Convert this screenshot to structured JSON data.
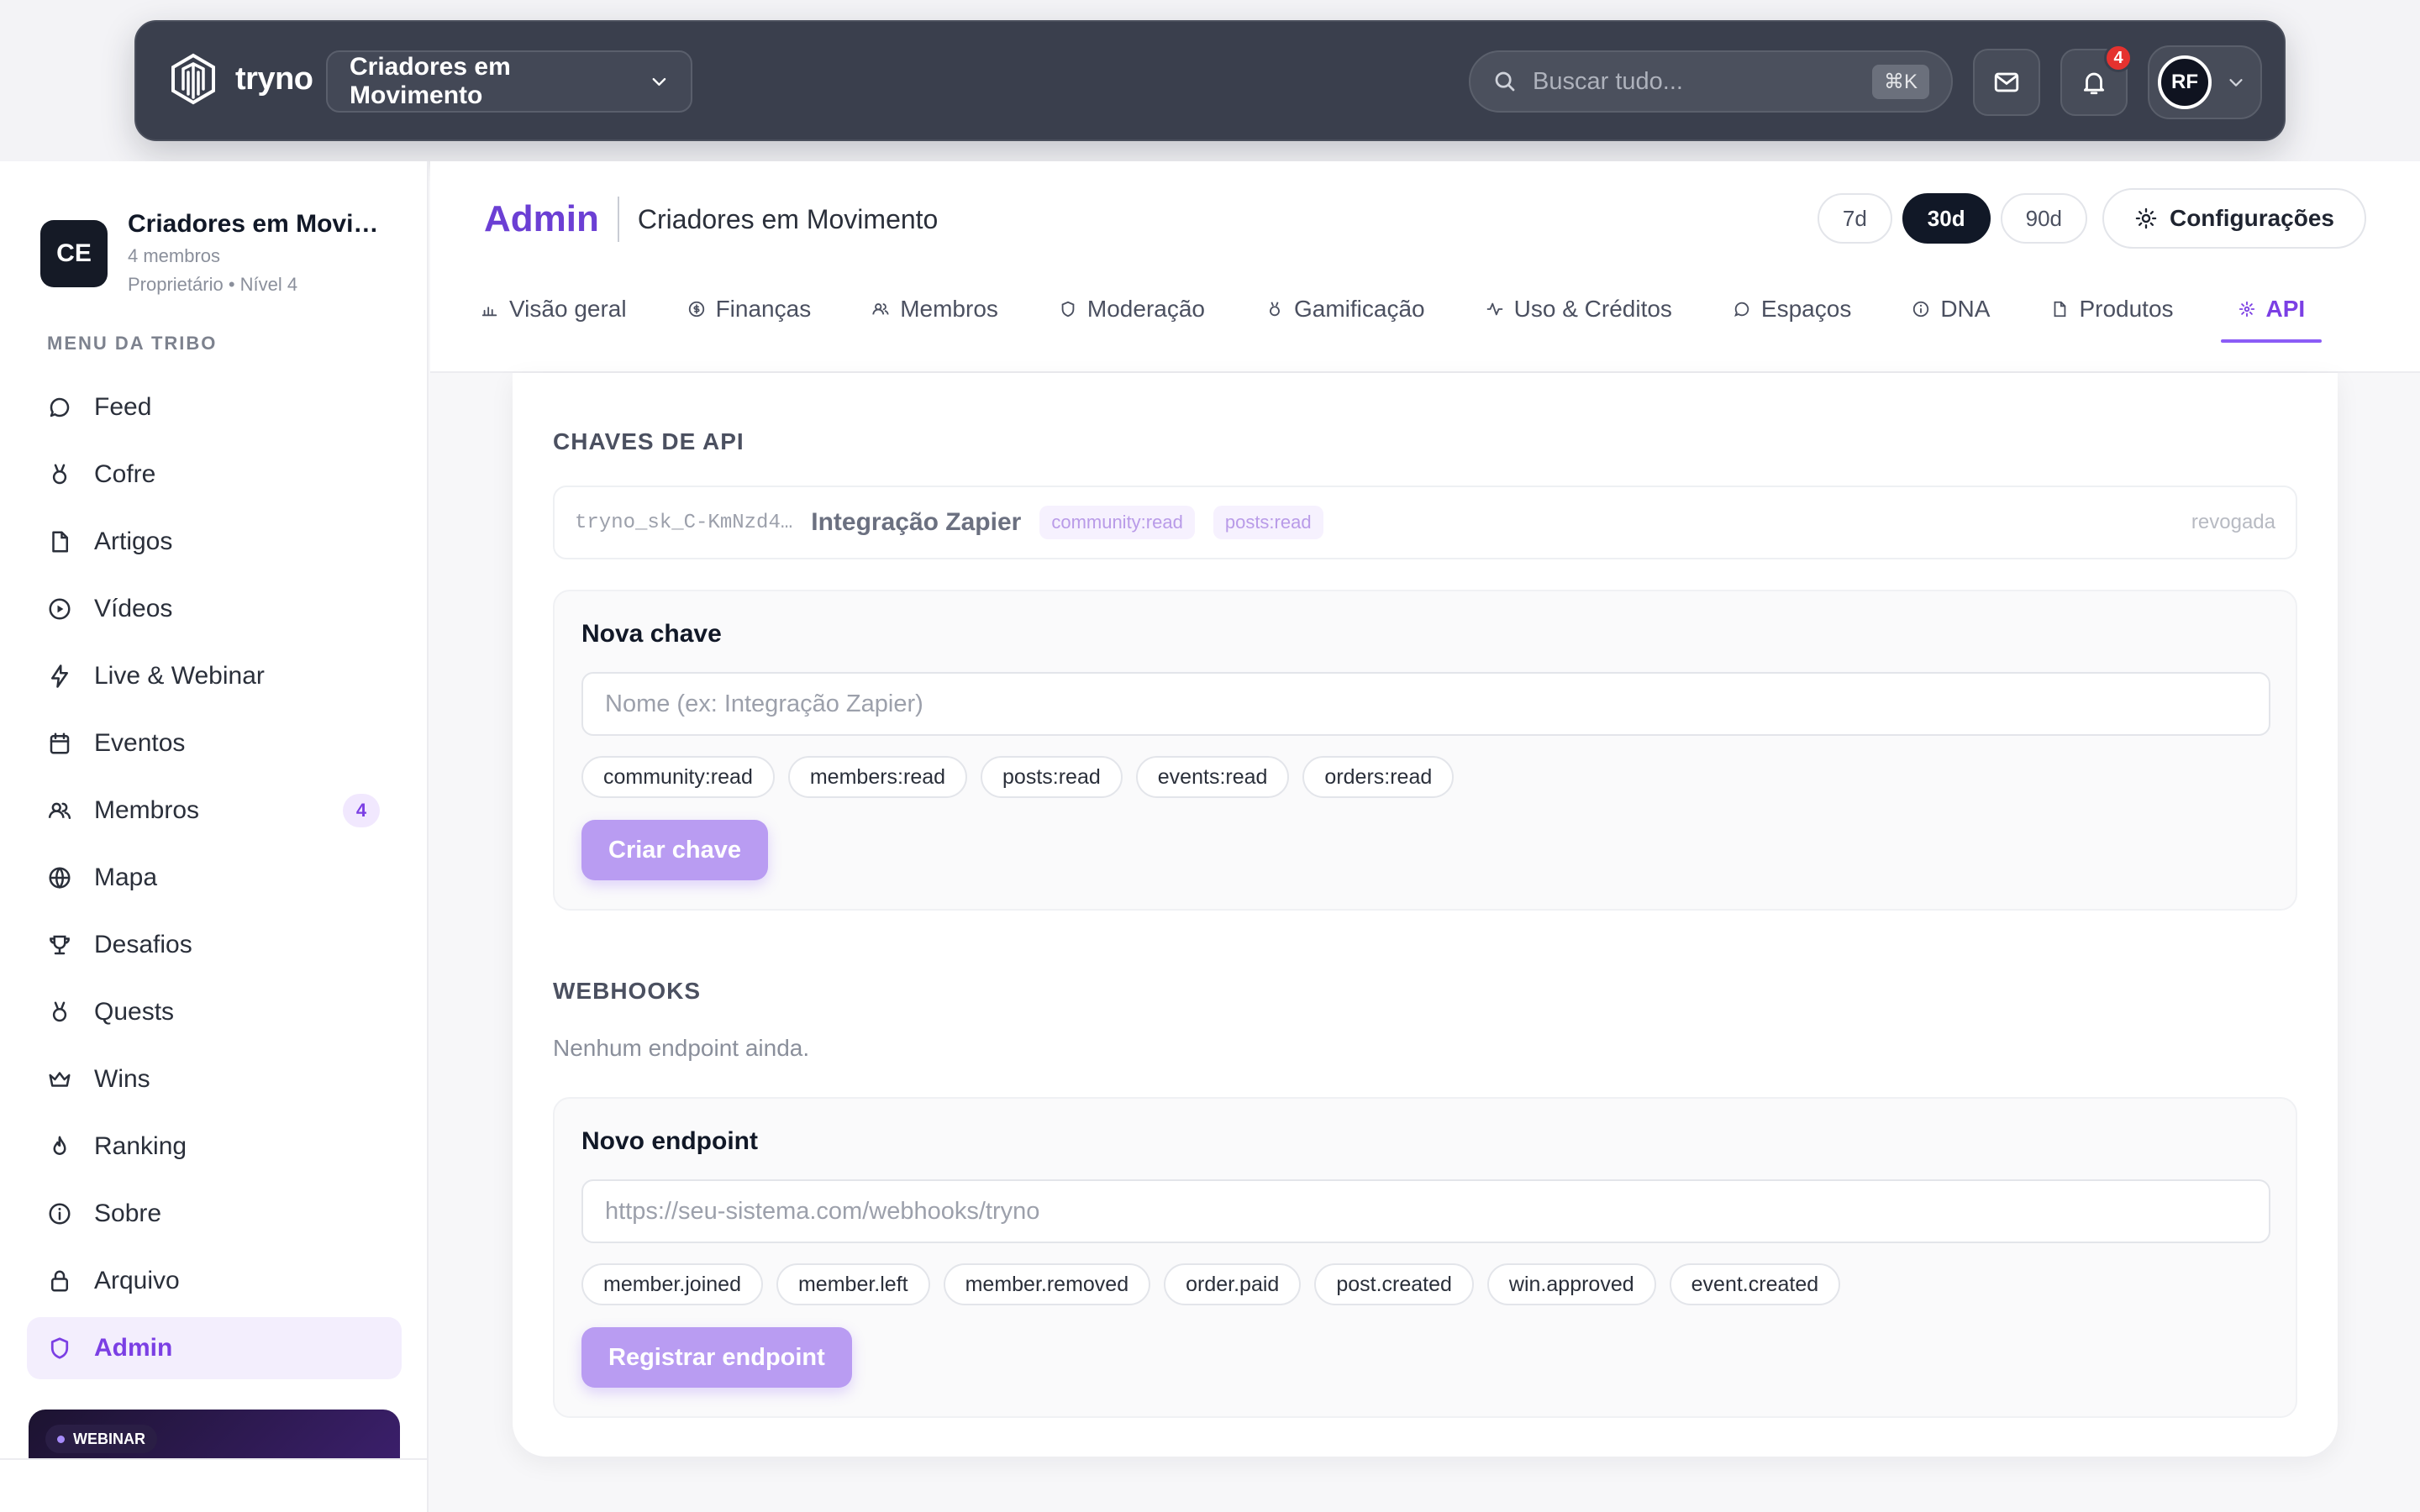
{
  "topbar": {
    "brand": "tryno",
    "community": "Criadores em Movimento",
    "search_placeholder": "Buscar tudo...",
    "search_shortcut": "⌘K",
    "notifications_count": "4",
    "user_initials": "RF"
  },
  "sidebar": {
    "tribe_initials": "CE",
    "tribe_name": "Criadores em Movimento",
    "tribe_members": "4 membros",
    "tribe_role": "Proprietário • Nível 4",
    "menu_title": "MENU DA TRIBO",
    "items": [
      {
        "label": "Feed",
        "icon": "chat-bubble-icon"
      },
      {
        "label": "Cofre",
        "icon": "medal-icon"
      },
      {
        "label": "Artigos",
        "icon": "document-icon"
      },
      {
        "label": "Vídeos",
        "icon": "play-circle-icon"
      },
      {
        "label": "Live & Webinar",
        "icon": "lightning-icon"
      },
      {
        "label": "Eventos",
        "icon": "calendar-icon"
      },
      {
        "label": "Membros",
        "icon": "users-icon",
        "badge": "4"
      },
      {
        "label": "Mapa",
        "icon": "globe-icon"
      },
      {
        "label": "Desafios",
        "icon": "trophy-icon"
      },
      {
        "label": "Quests",
        "icon": "medal-icon"
      },
      {
        "label": "Wins",
        "icon": "crown-icon"
      },
      {
        "label": "Ranking",
        "icon": "flame-icon"
      },
      {
        "label": "Sobre",
        "icon": "info-icon"
      },
      {
        "label": "Arquivo",
        "icon": "lock-icon"
      },
      {
        "label": "Admin",
        "icon": "shield-icon",
        "active": true
      }
    ],
    "webinar_tag": "WEBINAR"
  },
  "header": {
    "title": "Admin",
    "subtitle": "Criadores em Movimento",
    "ranges": [
      "7d",
      "30d",
      "90d"
    ],
    "active_range": "30d",
    "config_label": "Configurações",
    "tabs": [
      {
        "label": "Visão geral",
        "icon": "bar-chart-icon"
      },
      {
        "label": "Finanças",
        "icon": "dollar-circle-icon"
      },
      {
        "label": "Membros",
        "icon": "users-icon"
      },
      {
        "label": "Moderação",
        "icon": "shield-icon"
      },
      {
        "label": "Gamificação",
        "icon": "medal-icon"
      },
      {
        "label": "Uso & Créditos",
        "icon": "activity-icon"
      },
      {
        "label": "Espaços",
        "icon": "chat-bubble-icon"
      },
      {
        "label": "DNA",
        "icon": "info-icon"
      },
      {
        "label": "Produtos",
        "icon": "document-icon"
      },
      {
        "label": "API",
        "icon": "sparkle-icon",
        "active": true
      }
    ]
  },
  "api_keys": {
    "section_title": "CHAVES DE API",
    "key": {
      "code": "tryno_sk_C-KmNzd4…",
      "name": "Integração Zapier",
      "scopes": [
        "community:read",
        "posts:read"
      ],
      "status": "revogada"
    },
    "form": {
      "title": "Nova chave",
      "input_placeholder": "Nome (ex: Integração Zapier)",
      "scopes": [
        "community:read",
        "members:read",
        "posts:read",
        "events:read",
        "orders:read"
      ],
      "submit_label": "Criar chave"
    }
  },
  "webhooks": {
    "section_title": "WEBHOOKS",
    "empty_text": "Nenhum endpoint ainda.",
    "form": {
      "title": "Novo endpoint",
      "input_placeholder": "https://seu-sistema.com/webhooks/tryno",
      "events": [
        "member.joined",
        "member.left",
        "member.removed",
        "order.paid",
        "post.created",
        "win.approved",
        "event.created"
      ],
      "submit_label": "Registrar endpoint"
    }
  },
  "colors": {
    "accent": "#7b3fe4",
    "topbar_bg": "#3a3f4d",
    "primary_button": "#b99cf2",
    "badge_red": "#e5322f"
  }
}
